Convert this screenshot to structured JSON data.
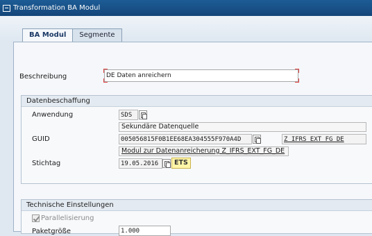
{
  "window": {
    "title": "Transformation BA Modul"
  },
  "tabs": [
    {
      "label": "BA Modul",
      "active": true
    },
    {
      "label": "Segmente",
      "active": false
    }
  ],
  "beschreibung": {
    "label": "Beschreibung",
    "value": "DE Daten anreichern"
  },
  "datenbeschaffung": {
    "title": "Datenbeschaffung",
    "anwendung": {
      "label": "Anwendung",
      "value": "SDS",
      "description": "Sekundäre Datenquelle"
    },
    "guid": {
      "label": "GUID",
      "value": "005056815F0B1EE68EA304555F970A4D",
      "class_value": "Z_IFRS_EXT_FG_DE",
      "description": "Modul zur Datenanreicherung Z_IFRS_EXT_FG_DE"
    },
    "stichtag": {
      "label": "Stichtag",
      "value": "19.05.2016",
      "badge": "ETS"
    }
  },
  "technische": {
    "title": "Technische Einstellungen",
    "parallelisierung": {
      "label": "Parallelisierung",
      "checked": true
    },
    "paketgroesse": {
      "label": "Paketgröße",
      "value": "1.000"
    }
  },
  "colors": {
    "titlebar": "#14467a",
    "page": "#f5f7fa",
    "badge": "#fff5a8"
  },
  "icons": {
    "copy": "copy-icon",
    "window": "window-icon",
    "check": "check-icon"
  }
}
